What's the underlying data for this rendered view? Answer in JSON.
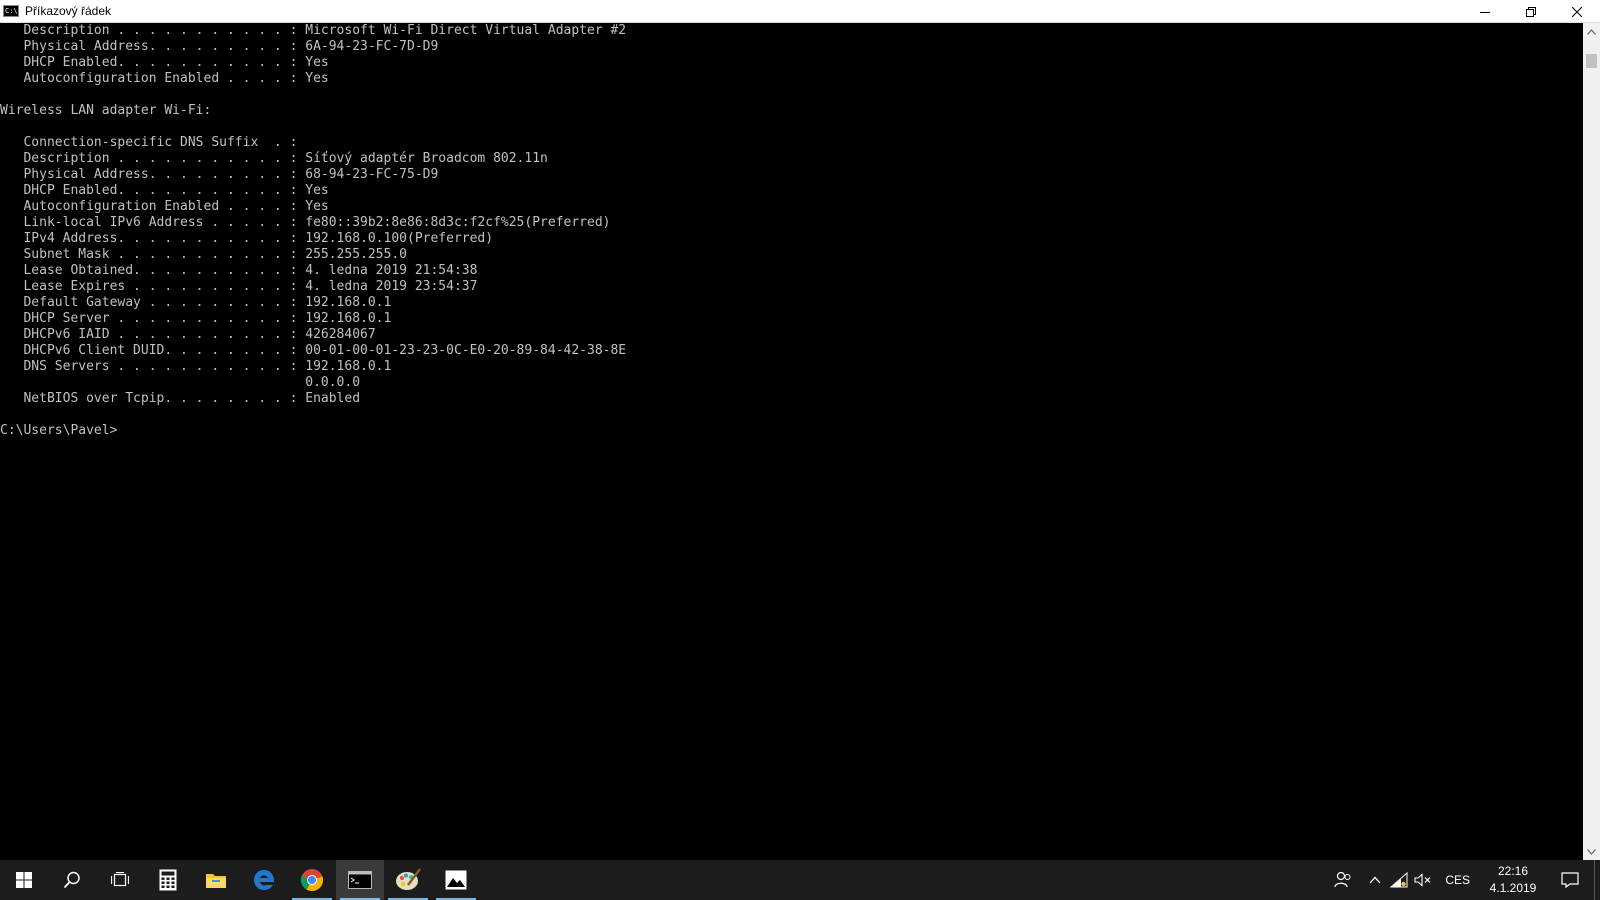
{
  "window": {
    "title": "Příkazový řádek",
    "icon": "cmd-icon",
    "icon_text": "C:\\"
  },
  "console": {
    "lines": [
      "   Description . . . . . . . . . . . : Microsoft Wi-Fi Direct Virtual Adapter #2",
      "   Physical Address. . . . . . . . . : 6A-94-23-FC-7D-D9",
      "   DHCP Enabled. . . . . . . . . . . : Yes",
      "   Autoconfiguration Enabled . . . . : Yes",
      "",
      "Wireless LAN adapter Wi-Fi:",
      "",
      "   Connection-specific DNS Suffix  . :",
      "   Description . . . . . . . . . . . : Síťový adaptér Broadcom 802.11n",
      "   Physical Address. . . . . . . . . : 68-94-23-FC-75-D9",
      "   DHCP Enabled. . . . . . . . . . . : Yes",
      "   Autoconfiguration Enabled . . . . : Yes",
      "   Link-local IPv6 Address . . . . . : fe80::39b2:8e86:8d3c:f2cf%25(Preferred)",
      "   IPv4 Address. . . . . . . . . . . : 192.168.0.100(Preferred)",
      "   Subnet Mask . . . . . . . . . . . : 255.255.255.0",
      "   Lease Obtained. . . . . . . . . . : 4. ledna 2019 21:54:38",
      "   Lease Expires . . . . . . . . . . : 4. ledna 2019 23:54:37",
      "   Default Gateway . . . . . . . . . : 192.168.0.1",
      "   DHCP Server . . . . . . . . . . . : 192.168.0.1",
      "   DHCPv6 IAID . . . . . . . . . . . : 426284067",
      "   DHCPv6 Client DUID. . . . . . . . : 00-01-00-01-23-23-0C-E0-20-89-84-42-38-8E",
      "   DNS Servers . . . . . . . . . . . : 192.168.0.1",
      "                                       0.0.0.0",
      "   NetBIOS over Tcpip. . . . . . . . : Enabled",
      "",
      "C:\\Users\\Pavel>"
    ]
  },
  "taskbar": {
    "items": [
      {
        "icon": "windows-start-icon",
        "active": false,
        "running": false
      },
      {
        "icon": "search-icon",
        "active": false,
        "running": false
      },
      {
        "icon": "task-view-icon",
        "active": false,
        "running": false
      },
      {
        "icon": "calculator-icon",
        "active": false,
        "running": false
      },
      {
        "icon": "file-explorer-icon",
        "active": false,
        "running": false
      },
      {
        "icon": "edge-browser-icon",
        "active": false,
        "running": false
      },
      {
        "icon": "chrome-browser-icon",
        "active": false,
        "running": true
      },
      {
        "icon": "command-prompt-icon",
        "active": true,
        "running": true
      },
      {
        "icon": "paint-app-icon",
        "active": false,
        "running": true
      },
      {
        "icon": "photos-app-icon",
        "active": false,
        "running": true
      }
    ],
    "tray": {
      "language": "CES",
      "time": "22:16",
      "date": "4.1.2019"
    }
  },
  "colors": {
    "console_bg": "#000000",
    "console_text": "#c0c0c0",
    "taskbar_bg": "#1c1c1c",
    "accent": "#76b9ed"
  }
}
